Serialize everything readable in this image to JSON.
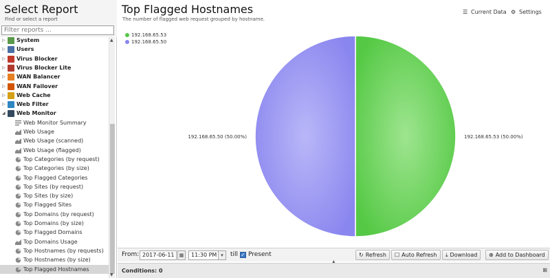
{
  "sidebar": {
    "title": "Select Report",
    "subtitle": "Find or select a report",
    "filter_placeholder": "Filter reports ...",
    "categories": [
      {
        "label": "System",
        "color": "#5b9a4a"
      },
      {
        "label": "Users",
        "color": "#4a6fa5"
      },
      {
        "label": "Virus Blocker",
        "color": "#c0392b"
      },
      {
        "label": "Virus Blocker Lite",
        "color": "#b03a2e"
      },
      {
        "label": "WAN Balancer",
        "color": "#e67e22"
      },
      {
        "label": "WAN Failover",
        "color": "#d35400"
      },
      {
        "label": "Web Cache",
        "color": "#d4a017"
      },
      {
        "label": "Web Filter",
        "color": "#2e86c1"
      },
      {
        "label": "Web Monitor",
        "color": "#34495e"
      }
    ],
    "reports": [
      "Web Monitor Summary",
      "Web Usage",
      "Web Usage (scanned)",
      "Web Usage (flagged)",
      "Top Categories (by request)",
      "Top Categories (by size)",
      "Top Flagged Categories",
      "Top Sites (by request)",
      "Top Sites (by size)",
      "Top Flagged Sites",
      "Top Domains (by request)",
      "Top Domains (by size)",
      "Top Flagged Domains",
      "Top Domains Usage",
      "Top Hostnames (by requests)",
      "Top Hostnames (by size)",
      "Top Flagged Hostnames"
    ],
    "selected_report": "Top Flagged Hostnames"
  },
  "header": {
    "title": "Top Flagged Hostnames",
    "description": "The number of flagged web request grouped by hostname.",
    "current_data_label": "Current Data",
    "settings_label": "Settings"
  },
  "chart_data": {
    "type": "pie",
    "slices": [
      {
        "label": "192.168.65.53",
        "value": 50.0,
        "color": "#55c945",
        "slice_label": "192.168.65.53 (50.00%)"
      },
      {
        "label": "192.168.65.50",
        "value": 50.0,
        "color": "#8a86ef",
        "slice_label": "192.168.65.50 (50.00%)"
      }
    ],
    "legend_position": "top-left"
  },
  "toolbar": {
    "from_label": "From:",
    "date": "2017-06-11",
    "time": "11:30 PM",
    "till_label": "till",
    "present_label": "Present",
    "present_checked": true,
    "refresh_label": "Refresh",
    "auto_refresh_label": "Auto Refresh",
    "download_label": "Download",
    "add_dashboard_label": "Add to Dashboard"
  },
  "conditions": {
    "label": "Conditions: 0"
  }
}
